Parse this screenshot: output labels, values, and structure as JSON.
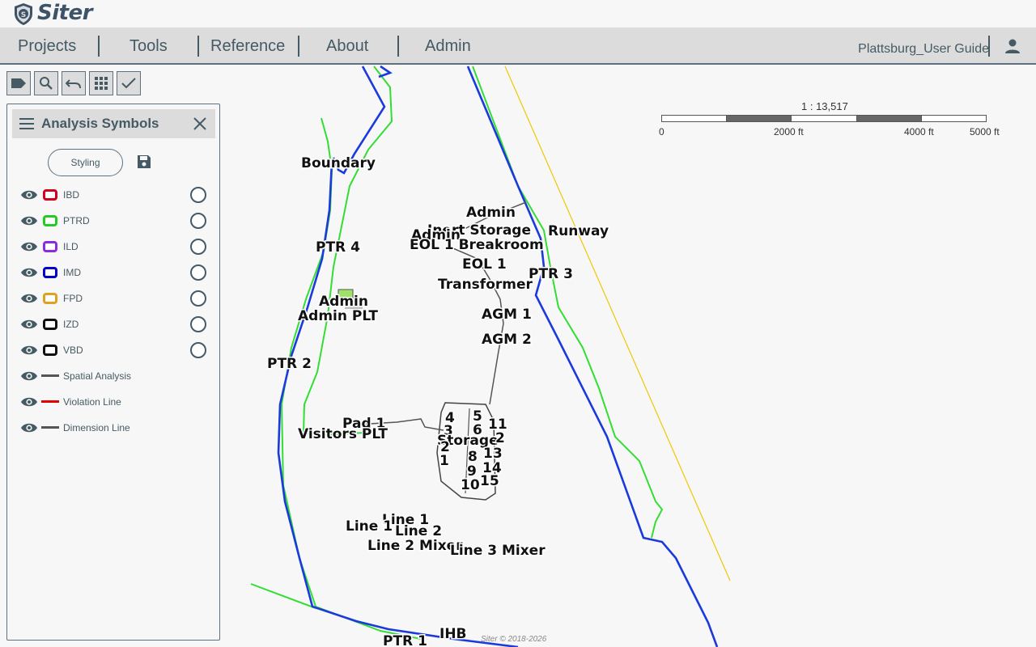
{
  "app": {
    "name": "Siter"
  },
  "nav": {
    "items": [
      "Projects",
      "Tools",
      "Reference",
      "About",
      "Admin"
    ],
    "user_guide": "Plattsburg_User Guide"
  },
  "toolbar": {
    "buttons": [
      "tag-icon",
      "search-icon",
      "undo-icon",
      "grid-icon",
      "check-icon"
    ]
  },
  "scale": {
    "ratio": "1 : 13,517",
    "labels": [
      "0",
      "2000 ft",
      "4000 ft",
      "5000 ft"
    ]
  },
  "panel": {
    "title": "Analysis Symbols",
    "styling_label": "Styling",
    "layers": [
      {
        "name": "IBD",
        "color": "#d0021b",
        "kind": "zone"
      },
      {
        "name": "PTRD",
        "color": "#22cc22",
        "kind": "zone"
      },
      {
        "name": "ILD",
        "color": "#8a2be2",
        "kind": "zone"
      },
      {
        "name": "IMD",
        "color": "#0000c8",
        "kind": "zone"
      },
      {
        "name": "FPD",
        "color": "#e0a020",
        "kind": "zone"
      },
      {
        "name": "IZD",
        "color": "#111111",
        "kind": "zone"
      },
      {
        "name": "VBD",
        "color": "#111111",
        "kind": "zone"
      },
      {
        "name": "Spatial Analysis",
        "color": "#555555",
        "kind": "line"
      },
      {
        "name": "Violation Line",
        "color": "#e00000",
        "kind": "line"
      },
      {
        "name": "Dimension Line",
        "color": "#555555",
        "kind": "line"
      }
    ]
  },
  "map": {
    "labels": [
      "Boundary",
      "PTR 4",
      "Admin",
      "Admin PLT",
      "PTR 2",
      "Admin",
      "Inert Storage",
      "Runway",
      "Admin",
      "EOL 1 Breakroom",
      "EOL 1",
      "Transformer",
      "PTR 3",
      "AGM 1",
      "AGM 2",
      "Pad 1",
      "Visitors PLT",
      "5",
      "6",
      "11",
      "4",
      "3",
      "Storage",
      "2",
      "2",
      "1",
      "8",
      "13",
      "9",
      "14",
      "10",
      "15",
      "Line 1",
      "Line 1",
      "Line 2",
      "Line 2 Mixer",
      "Line 3 Mixer",
      "PTR 1",
      "IHB"
    ]
  },
  "footer": "Siter © 2018-2026"
}
